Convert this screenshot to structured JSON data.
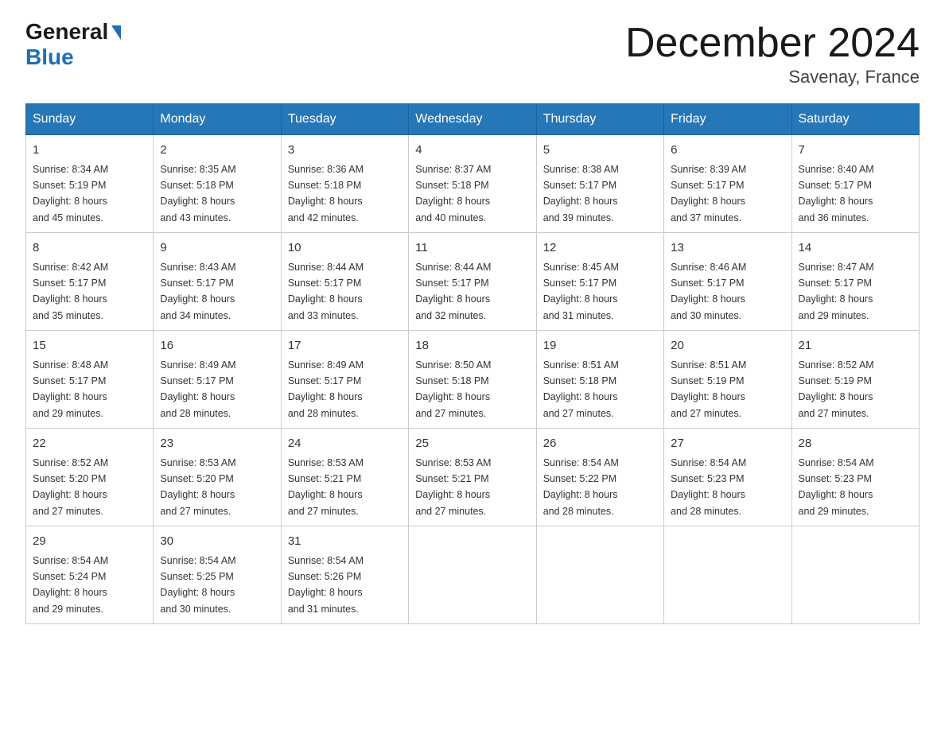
{
  "header": {
    "logo_general": "General",
    "logo_blue": "Blue",
    "month_title": "December 2024",
    "location": "Savenay, France"
  },
  "weekdays": [
    "Sunday",
    "Monday",
    "Tuesday",
    "Wednesday",
    "Thursday",
    "Friday",
    "Saturday"
  ],
  "weeks": [
    [
      {
        "day": "1",
        "sunrise": "8:34 AM",
        "sunset": "5:19 PM",
        "daylight": "8 hours and 45 minutes."
      },
      {
        "day": "2",
        "sunrise": "8:35 AM",
        "sunset": "5:18 PM",
        "daylight": "8 hours and 43 minutes."
      },
      {
        "day": "3",
        "sunrise": "8:36 AM",
        "sunset": "5:18 PM",
        "daylight": "8 hours and 42 minutes."
      },
      {
        "day": "4",
        "sunrise": "8:37 AM",
        "sunset": "5:18 PM",
        "daylight": "8 hours and 40 minutes."
      },
      {
        "day": "5",
        "sunrise": "8:38 AM",
        "sunset": "5:17 PM",
        "daylight": "8 hours and 39 minutes."
      },
      {
        "day": "6",
        "sunrise": "8:39 AM",
        "sunset": "5:17 PM",
        "daylight": "8 hours and 37 minutes."
      },
      {
        "day": "7",
        "sunrise": "8:40 AM",
        "sunset": "5:17 PM",
        "daylight": "8 hours and 36 minutes."
      }
    ],
    [
      {
        "day": "8",
        "sunrise": "8:42 AM",
        "sunset": "5:17 PM",
        "daylight": "8 hours and 35 minutes."
      },
      {
        "day": "9",
        "sunrise": "8:43 AM",
        "sunset": "5:17 PM",
        "daylight": "8 hours and 34 minutes."
      },
      {
        "day": "10",
        "sunrise": "8:44 AM",
        "sunset": "5:17 PM",
        "daylight": "8 hours and 33 minutes."
      },
      {
        "day": "11",
        "sunrise": "8:44 AM",
        "sunset": "5:17 PM",
        "daylight": "8 hours and 32 minutes."
      },
      {
        "day": "12",
        "sunrise": "8:45 AM",
        "sunset": "5:17 PM",
        "daylight": "8 hours and 31 minutes."
      },
      {
        "day": "13",
        "sunrise": "8:46 AM",
        "sunset": "5:17 PM",
        "daylight": "8 hours and 30 minutes."
      },
      {
        "day": "14",
        "sunrise": "8:47 AM",
        "sunset": "5:17 PM",
        "daylight": "8 hours and 29 minutes."
      }
    ],
    [
      {
        "day": "15",
        "sunrise": "8:48 AM",
        "sunset": "5:17 PM",
        "daylight": "8 hours and 29 minutes."
      },
      {
        "day": "16",
        "sunrise": "8:49 AM",
        "sunset": "5:17 PM",
        "daylight": "8 hours and 28 minutes."
      },
      {
        "day": "17",
        "sunrise": "8:49 AM",
        "sunset": "5:17 PM",
        "daylight": "8 hours and 28 minutes."
      },
      {
        "day": "18",
        "sunrise": "8:50 AM",
        "sunset": "5:18 PM",
        "daylight": "8 hours and 27 minutes."
      },
      {
        "day": "19",
        "sunrise": "8:51 AM",
        "sunset": "5:18 PM",
        "daylight": "8 hours and 27 minutes."
      },
      {
        "day": "20",
        "sunrise": "8:51 AM",
        "sunset": "5:19 PM",
        "daylight": "8 hours and 27 minutes."
      },
      {
        "day": "21",
        "sunrise": "8:52 AM",
        "sunset": "5:19 PM",
        "daylight": "8 hours and 27 minutes."
      }
    ],
    [
      {
        "day": "22",
        "sunrise": "8:52 AM",
        "sunset": "5:20 PM",
        "daylight": "8 hours and 27 minutes."
      },
      {
        "day": "23",
        "sunrise": "8:53 AM",
        "sunset": "5:20 PM",
        "daylight": "8 hours and 27 minutes."
      },
      {
        "day": "24",
        "sunrise": "8:53 AM",
        "sunset": "5:21 PM",
        "daylight": "8 hours and 27 minutes."
      },
      {
        "day": "25",
        "sunrise": "8:53 AM",
        "sunset": "5:21 PM",
        "daylight": "8 hours and 27 minutes."
      },
      {
        "day": "26",
        "sunrise": "8:54 AM",
        "sunset": "5:22 PM",
        "daylight": "8 hours and 28 minutes."
      },
      {
        "day": "27",
        "sunrise": "8:54 AM",
        "sunset": "5:23 PM",
        "daylight": "8 hours and 28 minutes."
      },
      {
        "day": "28",
        "sunrise": "8:54 AM",
        "sunset": "5:23 PM",
        "daylight": "8 hours and 29 minutes."
      }
    ],
    [
      {
        "day": "29",
        "sunrise": "8:54 AM",
        "sunset": "5:24 PM",
        "daylight": "8 hours and 29 minutes."
      },
      {
        "day": "30",
        "sunrise": "8:54 AM",
        "sunset": "5:25 PM",
        "daylight": "8 hours and 30 minutes."
      },
      {
        "day": "31",
        "sunrise": "8:54 AM",
        "sunset": "5:26 PM",
        "daylight": "8 hours and 31 minutes."
      },
      null,
      null,
      null,
      null
    ]
  ],
  "labels": {
    "sunrise": "Sunrise:",
    "sunset": "Sunset:",
    "daylight": "Daylight:"
  }
}
